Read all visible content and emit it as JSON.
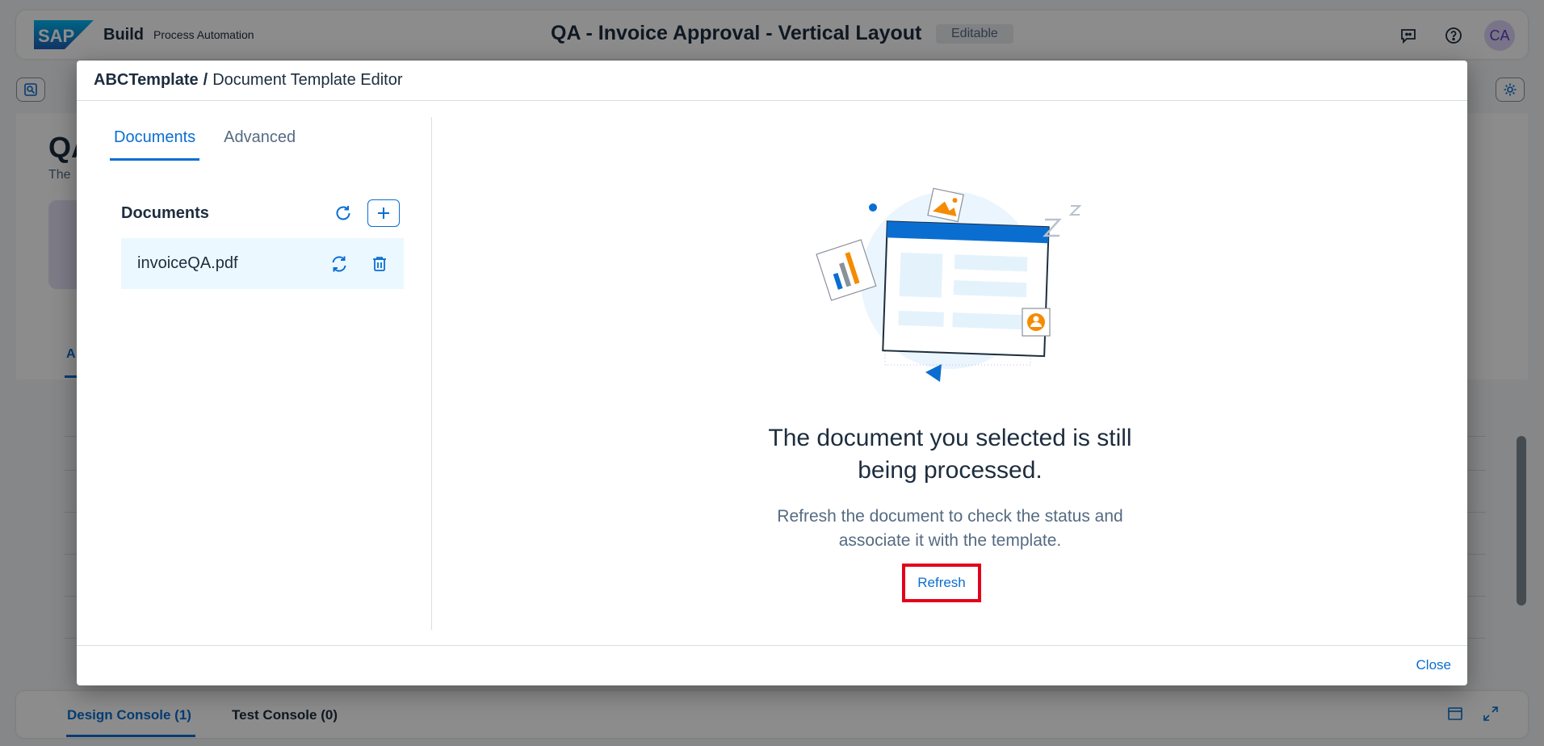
{
  "shell": {
    "logo_text": "SAP",
    "brand": "Build",
    "product": "Process Automation",
    "title": "QA - Invoice Approval - Vertical Layout",
    "badge": "Editable",
    "avatar_initials": "CA",
    "icons": [
      "feedback-icon",
      "help-icon"
    ]
  },
  "background": {
    "header_title": "QA",
    "header_sub": "The",
    "tab_label": "A"
  },
  "console": {
    "tabs": [
      {
        "label": "Design Console (1)",
        "active": true
      },
      {
        "label": "Test Console (0)",
        "active": false
      }
    ]
  },
  "dialog": {
    "breadcrumb_root": "ABCTemplate",
    "breadcrumb_sep": "/",
    "breadcrumb_current": "Document Template Editor",
    "tabs": [
      {
        "label": "Documents",
        "active": true
      },
      {
        "label": "Advanced",
        "active": false
      }
    ],
    "documents_title": "Documents",
    "documents": [
      {
        "name": "invoiceQA.pdf",
        "selected": true
      }
    ],
    "message_title_line1": "The document you selected is still",
    "message_title_line2": "being processed.",
    "message_desc_line1": "Refresh the document to check the status and",
    "message_desc_line2": "associate it with the template.",
    "refresh_label": "Refresh",
    "close_label": "Close"
  },
  "colors": {
    "accent": "#0a6ed1",
    "highlight_border": "#e3001b",
    "selected_row": "#ebf8ff",
    "illustration_orange": "#f58b00"
  }
}
